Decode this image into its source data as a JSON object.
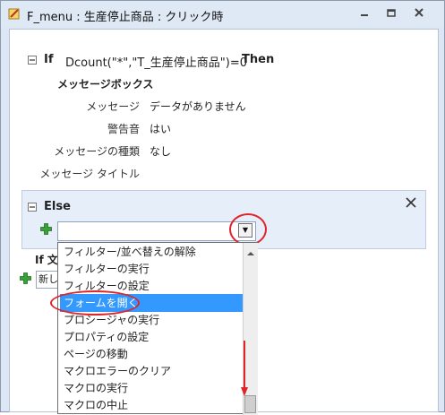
{
  "window": {
    "title": "F_menu : 生産停止商品 : クリック時"
  },
  "if_block": {
    "keyword_if": "If",
    "condition": "Dcount(\"*\",\"T_生産停止商品\")=0",
    "keyword_then": "Then",
    "action_name": "メッセージボックス",
    "params": [
      {
        "label": "メッセージ",
        "value": "データがありません"
      },
      {
        "label": "警告音",
        "value": "はい"
      },
      {
        "label": "メッセージの種類",
        "value": "なし"
      },
      {
        "label": "メッセージ タイトル",
        "value": ""
      }
    ]
  },
  "else_block": {
    "keyword": "Else",
    "combo_value": ""
  },
  "lower": {
    "if_text": "If 文",
    "new_text": "新し"
  },
  "dropdown": {
    "options": [
      "フィルター/並べ替えの解除",
      "フィルターの実行",
      "フィルターの設定",
      "フォームを開く",
      "プロシージャの実行",
      "プロパティの設定",
      "ページの移動",
      "マクロエラーのクリア",
      "マクロの実行",
      "マクロの中止"
    ],
    "selected_index": 3
  },
  "icons": {
    "app": "macro-icon",
    "minimize": "minimize-icon",
    "restore": "restore-icon",
    "close": "close-icon",
    "collapse": "collapse-icon",
    "add": "add-icon",
    "delete": "delete-icon",
    "dropdown": "chevron-down-icon"
  },
  "colors": {
    "highlight": "#3399ff",
    "annotation": "#e0242a",
    "add_icon": "#3aa13a"
  }
}
